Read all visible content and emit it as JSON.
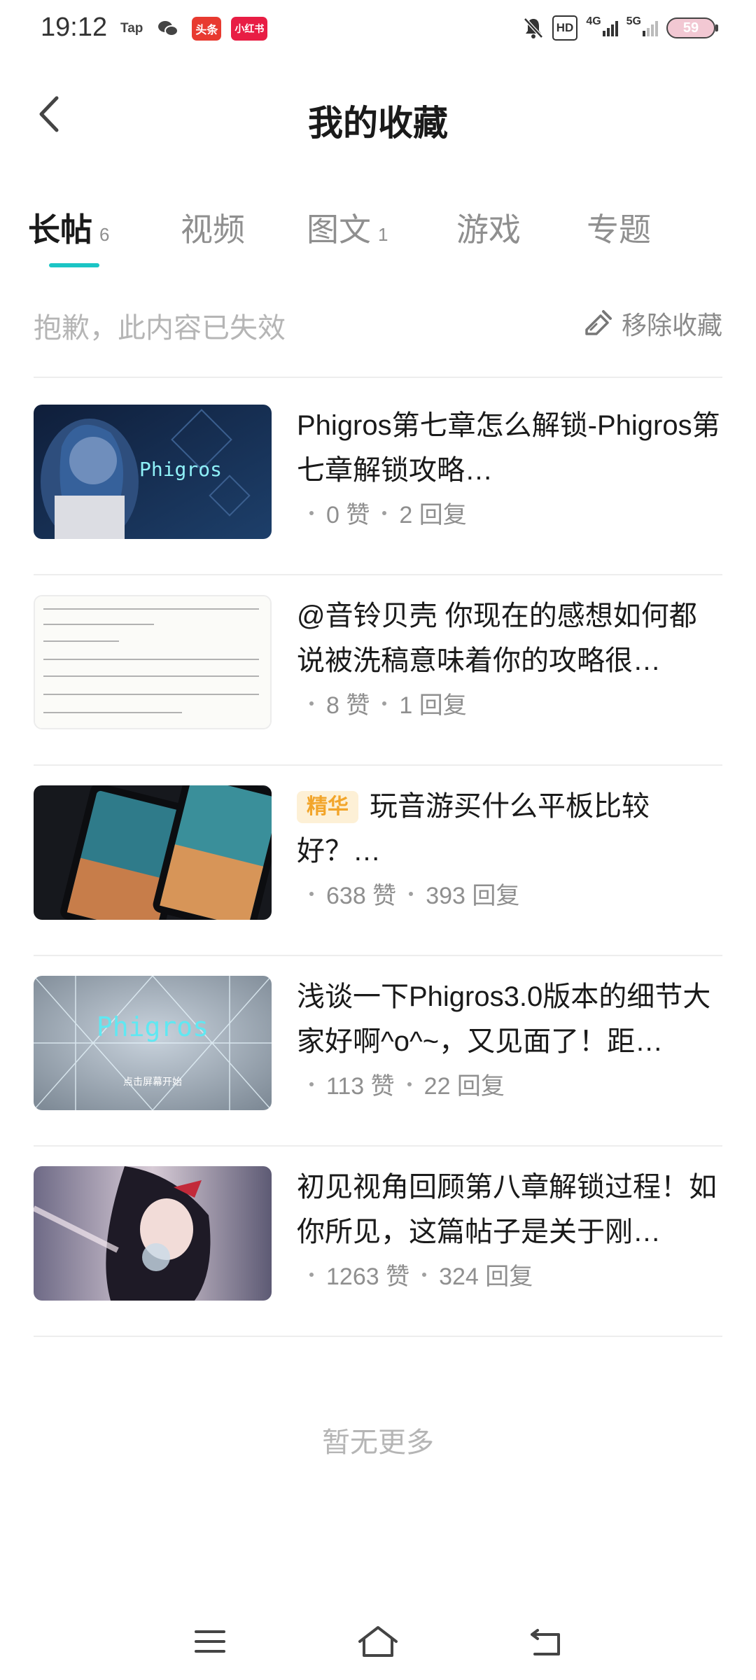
{
  "status_bar": {
    "time": "19:12",
    "apps": [
      "Tap",
      "头条",
      "小红书"
    ],
    "hd_label": "HD",
    "net1": "4G",
    "net2": "5G",
    "battery": "59"
  },
  "header": {
    "title": "我的收藏"
  },
  "tabs": [
    {
      "label": "长帖",
      "count": "6",
      "active": true
    },
    {
      "label": "视频",
      "count": ""
    },
    {
      "label": "图文",
      "count": "1"
    },
    {
      "label": "游戏",
      "count": ""
    },
    {
      "label": "专题",
      "count": ""
    }
  ],
  "notice": {
    "text": "抱歉，此内容已失效",
    "remove_label": "移除收藏"
  },
  "posts": [
    {
      "title": "Phigros第七章怎么解锁-Phigros第七章解锁攻略…",
      "badge": "",
      "likes": "0 赞",
      "replies": "2 回复",
      "thumb_text": "Phigros"
    },
    {
      "title": "@音铃贝壳 你现在的感想如何都说被洗稿意味着你的攻略很…",
      "badge": "",
      "likes": "8 赞",
      "replies": "1 回复",
      "thumb_text": ""
    },
    {
      "title": "玩音游买什么平板比较好？…",
      "badge": "精华",
      "likes": "638 赞",
      "replies": "393 回复",
      "thumb_text": ""
    },
    {
      "title": "浅谈一下Phigros3.0版本的细节大家好啊^o^~，又见面了！距…",
      "badge": "",
      "likes": "113 赞",
      "replies": "22 回复",
      "thumb_text": "Phigros",
      "thumb_sub": "点击屏幕开始"
    },
    {
      "title": "初见视角回顾第八章解锁过程！如你所见，这篇帖子是关于刚…",
      "badge": "",
      "likes": "1263 赞",
      "replies": "324 回复",
      "thumb_text": ""
    }
  ],
  "footer": {
    "no_more": "暂无更多"
  },
  "colors": {
    "accent": "#1bc5c5",
    "badge_text": "#f2a52b",
    "badge_bg": "#fdf0d6"
  }
}
